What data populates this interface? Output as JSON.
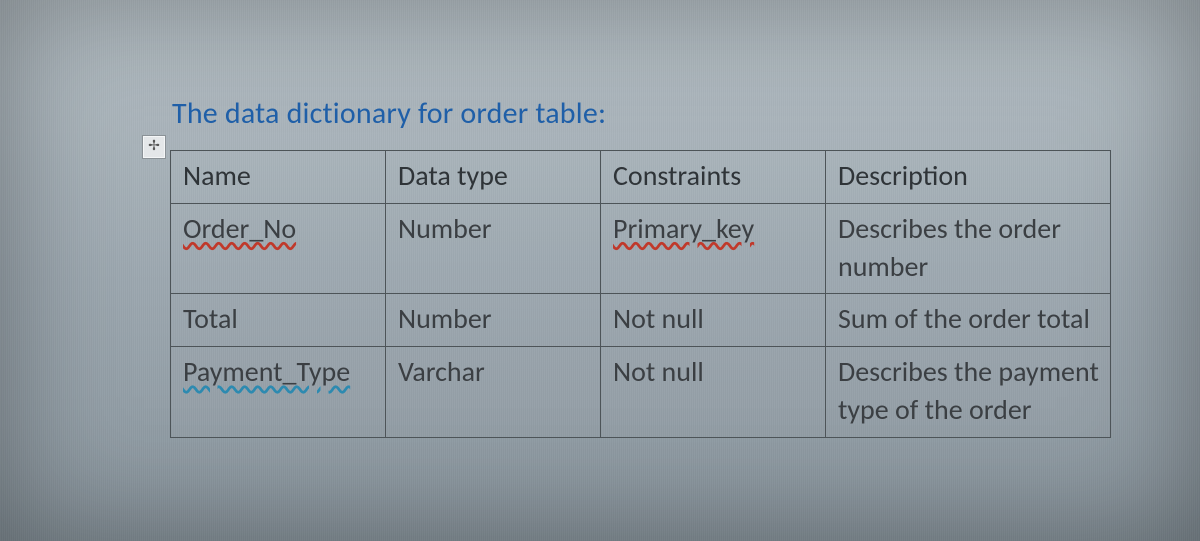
{
  "title": "The data dictionary for order table:",
  "anchor_glyph": "✢",
  "table": {
    "headers": {
      "name": "Name",
      "data_type": "Data type",
      "constraints": "Constraints",
      "description": "Description"
    },
    "rows": [
      {
        "name": "Order_No",
        "data_type": "Number",
        "constraints": "Primary_key",
        "description": "Describes the order number"
      },
      {
        "name": "Total",
        "data_type": "Number",
        "constraints": "Not null",
        "description": "Sum of the order total"
      },
      {
        "name": "Payment_Type",
        "data_type": "Varchar",
        "constraints": "Not null",
        "description": "Describes the payment type of the order"
      }
    ]
  }
}
